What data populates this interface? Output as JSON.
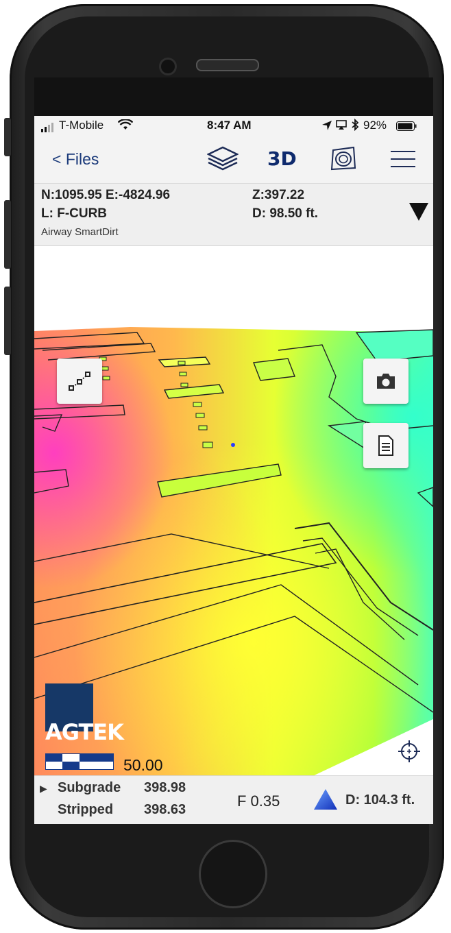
{
  "status": {
    "carrier": "T-Mobile",
    "time": "8:47 AM",
    "battery": "92%"
  },
  "nav": {
    "back_label": "< Files",
    "mode_label": "3D",
    "icons": [
      "layers-icon",
      "surface-view-icon",
      "menu-icon"
    ]
  },
  "info": {
    "coords": "N:1095.95 E:-4824.96",
    "z": "Z:397.22",
    "layer": "L: F-CURB",
    "distance": "D: 98.50 ft.",
    "project": "Airway SmartDirt"
  },
  "map": {
    "logo_text": "AGTEK",
    "scale_value": "50.00",
    "colors": {
      "high": "#ff3fbf",
      "mid": "#ffa64d",
      "low": "#d8ff33",
      "lowest": "#33ffcc"
    }
  },
  "bottom": {
    "subgrade_label": "Subgrade",
    "subgrade_value": "398.98",
    "stripped_label": "Stripped",
    "stripped_value": "398.63",
    "fill": "F 0.35",
    "distance": "D: 104.3 ft."
  }
}
